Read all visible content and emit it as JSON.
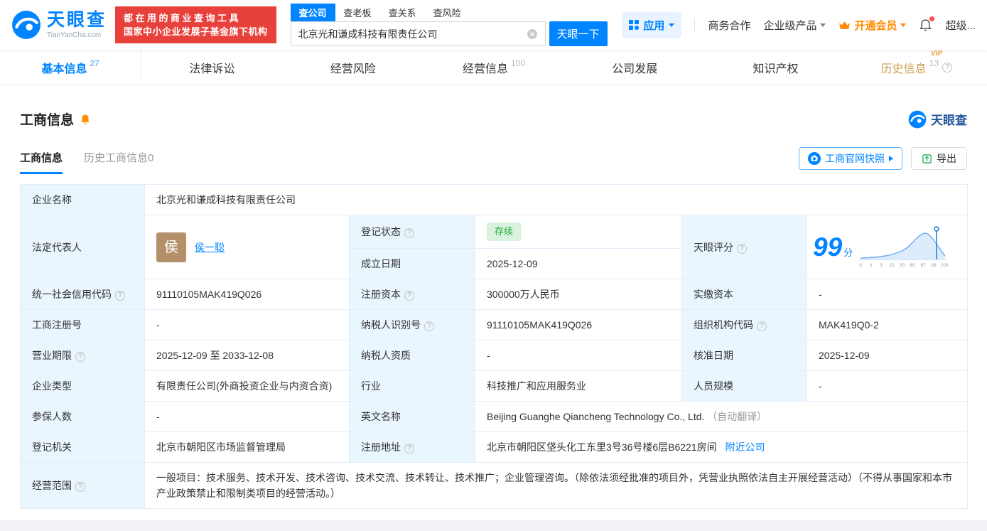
{
  "icons": {
    "help": "?"
  },
  "header": {
    "brand": "天眼查",
    "brand_domain": "TianYanCha.com",
    "promo_line1": "都在用的商业查询工具",
    "promo_line2": "国家中小企业发展子基金旗下机构",
    "search_tabs": [
      {
        "label": "查公司"
      },
      {
        "label": "查老板"
      },
      {
        "label": "查关系"
      },
      {
        "label": "查风险"
      }
    ],
    "search_value": "北京光和谦成科技有限责任公司",
    "search_button": "天眼一下",
    "apps_label": "应用",
    "links": {
      "biz_coop": "商务合作",
      "enterprise": "企业级产品",
      "vip": "开通会员",
      "super": "超级..."
    }
  },
  "nav_tabs": [
    {
      "label": "基本信息",
      "count": "27"
    },
    {
      "label": "法律诉讼",
      "count": ""
    },
    {
      "label": "经营风险",
      "count": ""
    },
    {
      "label": "经营信息",
      "count": "100"
    },
    {
      "label": "公司发展",
      "count": ""
    },
    {
      "label": "知识产权",
      "count": ""
    },
    {
      "label": "历史信息",
      "count": "13",
      "vip": "VIP"
    }
  ],
  "section": {
    "title": "工商信息",
    "brand": "天眼查",
    "subtabs": [
      {
        "label": "工商信息"
      },
      {
        "label": "历史工商信息0"
      }
    ],
    "snapshot_button": "工商官网快照",
    "export_button": "导出"
  },
  "biz": {
    "company_name_label": "企业名称",
    "company_name": "北京光和谦成科技有限责任公司",
    "legal_rep_label": "法定代表人",
    "legal_rep_avatar": "侯",
    "legal_rep_name": "侯一聪",
    "reg_status_label": "登记状态",
    "reg_status": "存续",
    "established_label": "成立日期",
    "established": "2025-12-09",
    "score_label": "天眼评分",
    "score": "99",
    "score_unit": "分",
    "score_axis": [
      "0",
      "1",
      "3",
      "15",
      "50",
      "85",
      "97",
      "99",
      "100"
    ],
    "credit_code_label": "统一社会信用代码",
    "credit_code": "91110105MAK419Q026",
    "reg_capital_label": "注册资本",
    "reg_capital": "300000万人民币",
    "paid_capital_label": "实缴资本",
    "paid_capital": "-",
    "reg_no_label": "工商注册号",
    "reg_no": "-",
    "taxpayer_id_label": "纳税人识别号",
    "taxpayer_id": "91110105MAK419Q026",
    "org_code_label": "组织机构代码",
    "org_code": "MAK419Q0-2",
    "term_label": "营业期限",
    "term": "2025-12-09 至 2033-12-08",
    "taxpayer_quality_label": "纳税人资质",
    "taxpayer_quality": "-",
    "approval_date_label": "核准日期",
    "approval_date": "2025-12-09",
    "company_type_label": "企业类型",
    "company_type": "有限责任公司(外商投资企业与内资合资)",
    "industry_label": "行业",
    "industry": "科技推广和应用服务业",
    "staff_label": "人员规模",
    "staff": "-",
    "insured_label": "参保人数",
    "insured": "-",
    "en_name_label": "英文名称",
    "en_name": "Beijing Guanghe Qiancheng Technology Co., Ltd.",
    "en_name_note": "（自动翻译）",
    "authority_label": "登记机关",
    "authority": "北京市朝阳区市场监督管理局",
    "address_label": "注册地址",
    "address": "北京市朝阳区垡头化工东里3号36号楼6层B6221房间",
    "address_link": "附近公司",
    "scope_label": "经营范围",
    "scope": "一般项目：技术服务、技术开发、技术咨询、技术交流、技术转让、技术推广；企业管理咨询。（除依法须经批准的项目外，凭营业执照依法自主开展经营活动）（不得从事国家和本市产业政策禁止和限制类项目的经营活动。）"
  }
}
